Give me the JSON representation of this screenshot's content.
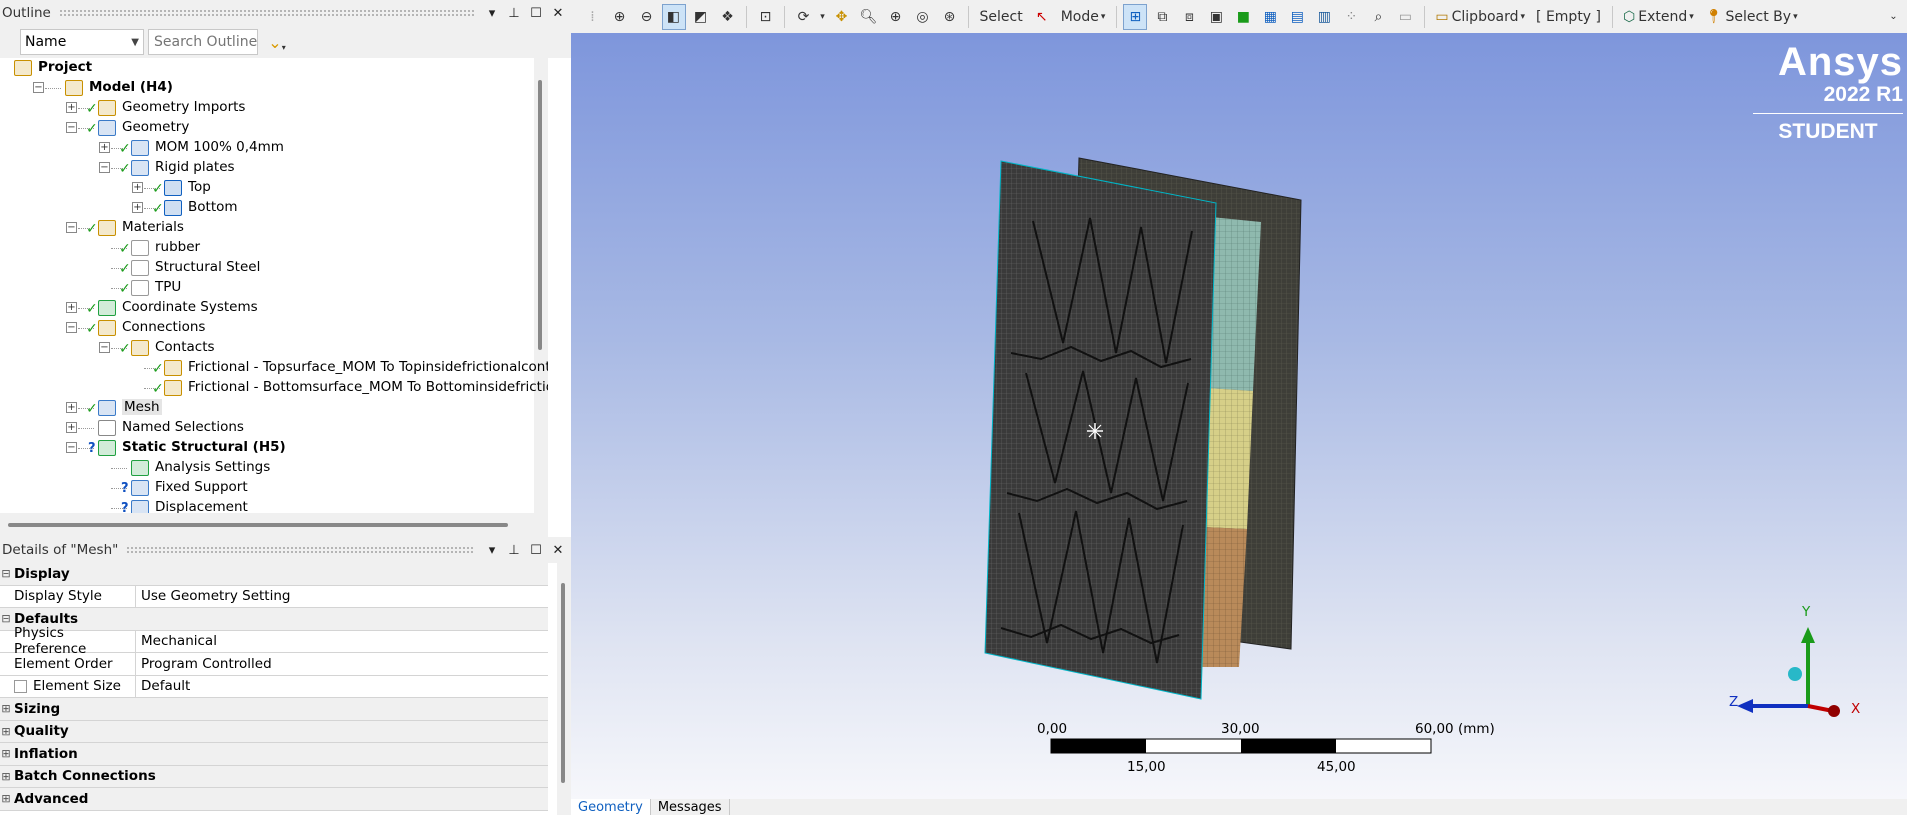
{
  "outline": {
    "title": "Outline",
    "name_filter": "Name",
    "search_placeholder": "Search Outline",
    "tree": [
      {
        "label": "Project",
        "bold": true
      },
      {
        "label": "Model (H4)",
        "bold": true
      },
      {
        "label": "Geometry Imports"
      },
      {
        "label": "Geometry"
      },
      {
        "label": "MOM 100% 0,4mm"
      },
      {
        "label": "Rigid plates"
      },
      {
        "label": "Top"
      },
      {
        "label": "Bottom"
      },
      {
        "label": "Materials"
      },
      {
        "label": "rubber"
      },
      {
        "label": "Structural Steel"
      },
      {
        "label": "TPU"
      },
      {
        "label": "Coordinate Systems"
      },
      {
        "label": "Connections"
      },
      {
        "label": "Contacts"
      },
      {
        "label": "Frictional - Topsurface_MOM To Topinsidefrictionalcontact"
      },
      {
        "label": "Frictional - Bottomsurface_MOM To Bottominsidefrictionalcontac"
      },
      {
        "label": "Mesh",
        "selected": true
      },
      {
        "label": "Named Selections"
      },
      {
        "label": "Static Structural (H5)",
        "bold": true
      },
      {
        "label": "Analysis Settings"
      },
      {
        "label": "Fixed Support"
      },
      {
        "label": "Displacement"
      }
    ]
  },
  "details": {
    "title": "Details of \"Mesh\"",
    "rows": [
      {
        "group": "Display"
      },
      {
        "key": "Display Style",
        "value": "Use Geometry Setting"
      },
      {
        "group": "Defaults"
      },
      {
        "key": "Physics Preference",
        "value": "Mechanical"
      },
      {
        "key": "Element Order",
        "value": "Program Controlled"
      },
      {
        "key": "Element Size",
        "value": "Default",
        "checkbox": true
      },
      {
        "group": "Sizing",
        "collapsed": true
      },
      {
        "group": "Quality",
        "collapsed": true
      },
      {
        "group": "Inflation",
        "collapsed": true
      },
      {
        "group": "Batch Connections",
        "collapsed": true
      },
      {
        "group": "Advanced",
        "collapsed": true
      }
    ]
  },
  "toolbar": {
    "select_label": "Select",
    "mode_label": "Mode",
    "clipboard_label": "Clipboard",
    "empty_label": "[ Empty ]",
    "extend_label": "Extend",
    "select_by_label": "Select By"
  },
  "brand": {
    "logo": "Ansys",
    "version": "2022 R1",
    "edition": "STUDENT"
  },
  "scale_bar": {
    "top_labels": [
      "0,00",
      "30,00",
      "60,00 (mm)"
    ],
    "bottom_labels": [
      "15,00",
      "45,00"
    ]
  },
  "triad": {
    "x": "X",
    "y": "Y",
    "z": "Z"
  },
  "bottom_tabs": [
    "Geometry",
    "Messages"
  ],
  "colors": {
    "check_green": "#1a9b1a",
    "selection_blue": "#cde3f7",
    "viewport_top": "#7e96dc",
    "mesh_dark": "#3a3a3a"
  }
}
